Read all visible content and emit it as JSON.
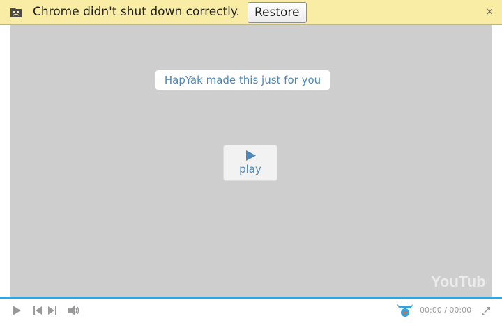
{
  "infobar": {
    "message": "Chrome didn't shut down correctly.",
    "restore_label": "Restore",
    "close_glyph": "×",
    "icon": "crashed-page-icon"
  },
  "player": {
    "overlay_label": "HapYak made this just for you",
    "play_label": "play",
    "watermark": "YouTube",
    "progress": 0,
    "accent_color": "#3aa0d8",
    "link_color": "#4d86b7",
    "time": {
      "current": "00:00",
      "separator": "/",
      "duration": "00:00"
    },
    "controls": [
      "play-icon",
      "previous-icon",
      "next-icon",
      "volume-icon",
      "hapyak-logo-icon",
      "fullscreen-icon"
    ]
  }
}
